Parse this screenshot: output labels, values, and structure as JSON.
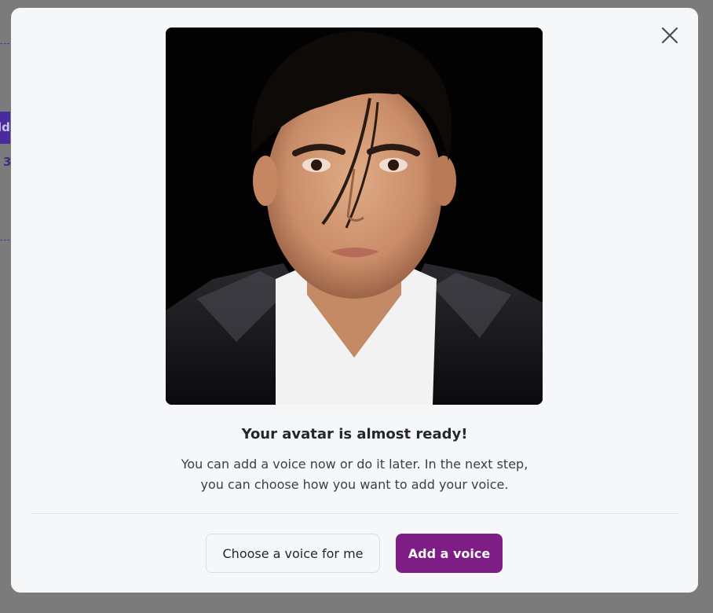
{
  "background": {
    "button_fragment": "ld",
    "number_fragment": "3"
  },
  "modal": {
    "close_icon": "close-icon",
    "avatar_image": "avatar-photo",
    "title": "Your avatar is almost ready!",
    "description_line1": "You can add a voice now or do it later. In the next step,",
    "description_line2": "you can choose how you want to add your voice.",
    "secondary_button": "Choose a voice for me",
    "primary_button": "Add a voice"
  },
  "colors": {
    "overlay": "#7b7b7b",
    "modal_bg": "#f6f7f9",
    "primary": "#7e1d86",
    "background_accent": "#4b2a9e"
  }
}
